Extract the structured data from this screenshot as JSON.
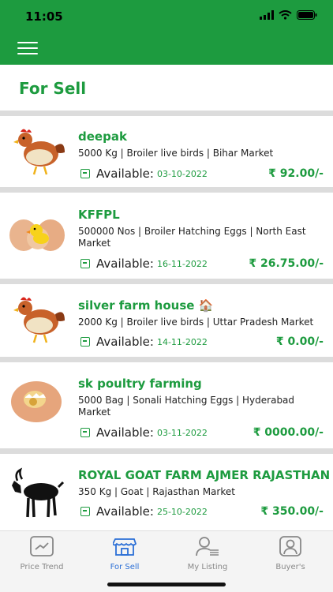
{
  "status": {
    "time": "11:05"
  },
  "page": {
    "title": "For Sell"
  },
  "listings": [
    {
      "name": "deepak",
      "description": "5000 Kg | Broiler live birds | Bihar Market",
      "available_label": "Available:",
      "date": "03-10-2022",
      "price": "₹ 92.00/-",
      "image": "chicken"
    },
    {
      "name": "KFFPL",
      "description": "500000 Nos | Broiler Hatching Eggs | North East Market",
      "available_label": "Available:",
      "date": "16-11-2022",
      "price": "₹ 26.75.00/-",
      "image": "eggs-chick"
    },
    {
      "name": "silver farm house 🏠",
      "description": "2000 Kg | Broiler live birds | Uttar Pradesh Market",
      "available_label": "Available:",
      "date": "14-11-2022",
      "price": "₹ 0.00/-",
      "image": "chicken"
    },
    {
      "name": "sk poultry farming",
      "description": "5000 Bag | Sonali Hatching Eggs | Hyderabad Market",
      "available_label": "Available:",
      "date": "03-11-2022",
      "price": "₹ 0000.00/-",
      "image": "egg-hatching"
    },
    {
      "name": "ROYAL GOAT FARM AJMER RAJASTHAN",
      "description": "350 Kg | Goat | Rajasthan Market",
      "available_label": "Available:",
      "date": "25-10-2022",
      "price": "₹ 350.00/-",
      "image": "goat"
    }
  ],
  "tabs": [
    {
      "label": "Price Trend",
      "icon": "chart-icon",
      "active": false
    },
    {
      "label": "For Sell",
      "icon": "store-icon",
      "active": true
    },
    {
      "label": "My Listing",
      "icon": "user-list-icon",
      "active": false
    },
    {
      "label": "Buyer's",
      "icon": "user-icon",
      "active": false
    }
  ],
  "colors": {
    "primary": "#1d9b3f",
    "active_tab": "#2b6fd6"
  }
}
